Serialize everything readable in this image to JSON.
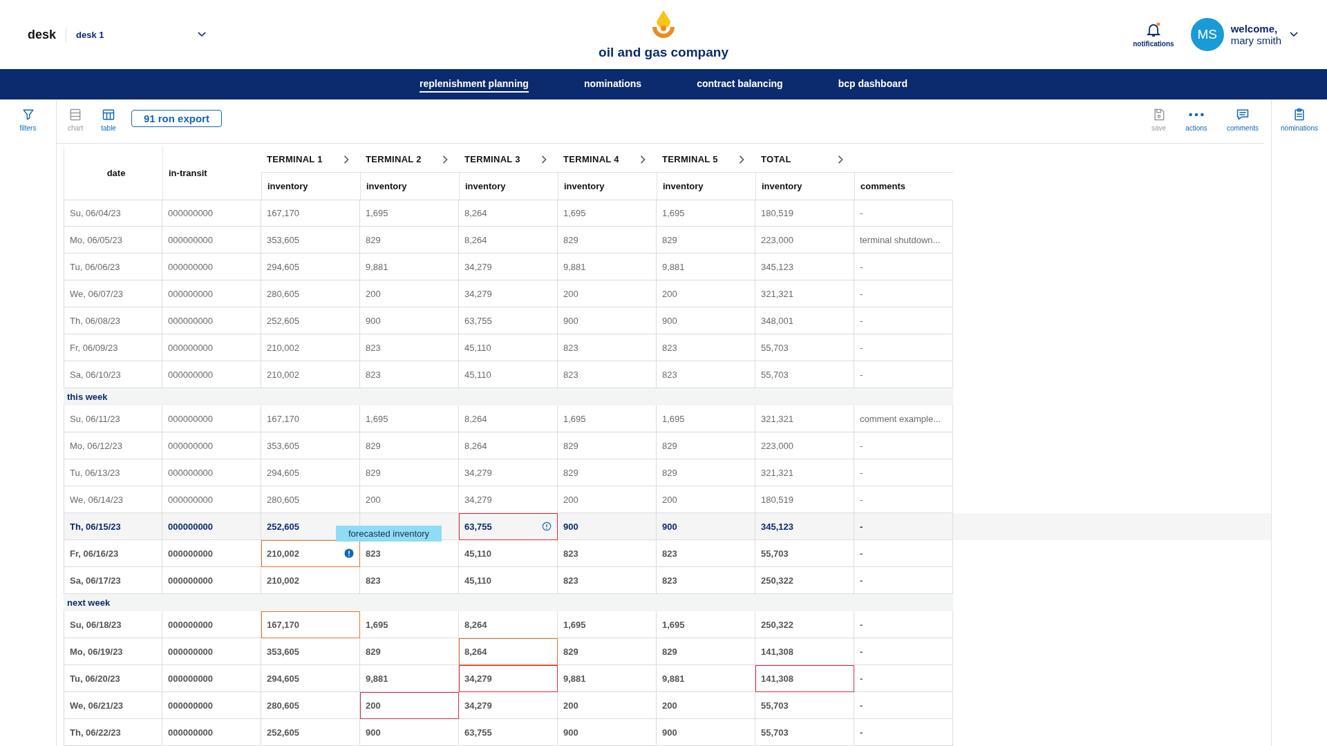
{
  "header": {
    "desk_label": "desk",
    "desk_select": "desk 1",
    "company": "oil and gas company",
    "notifications": "notifications",
    "avatar": "MS",
    "greeting": "welcome,",
    "user": "mary smith"
  },
  "nav": [
    {
      "label": "replenishment planning",
      "selected": true
    },
    {
      "label": "nominations",
      "selected": false
    },
    {
      "label": "contract balancing",
      "selected": false
    },
    {
      "label": "bcp dashboard",
      "selected": false
    }
  ],
  "toolbar": {
    "filters": "filters",
    "views": [
      {
        "kind": "chart",
        "label": "chart",
        "selected": false
      },
      {
        "kind": "table",
        "label": "table",
        "selected": true
      }
    ],
    "export_button": "91 ron export",
    "actions": [
      {
        "kind": "save",
        "label": "save",
        "disabled": true
      },
      {
        "kind": "actions",
        "label": "actions",
        "disabled": false
      },
      {
        "kind": "comments",
        "label": "comments",
        "disabled": false
      }
    ],
    "side_panel": "nominations"
  },
  "table": {
    "columns": [
      {
        "kind": "span",
        "label": "date"
      },
      {
        "kind": "span",
        "label": "in-transit"
      },
      {
        "kind": "group",
        "title": "TERMINAL 1",
        "label": "inventory"
      },
      {
        "kind": "group",
        "title": "TERMINAL 2",
        "label": "inventory"
      },
      {
        "kind": "group",
        "title": "TERMINAL 3",
        "label": "inventory"
      },
      {
        "kind": "group",
        "title": "TERMINAL 4",
        "label": "inventory"
      },
      {
        "kind": "group",
        "title": "TERMINAL 5",
        "label": "inventory"
      },
      {
        "kind": "group",
        "title": "TOTAL",
        "label": "inventory"
      },
      {
        "kind": "sub",
        "label": "comments"
      }
    ],
    "sections": [
      {
        "rows": [
          {
            "kind": "past",
            "selected": false,
            "cells": [
              "Su, 06/04/23",
              "000000000",
              "167,170",
              "1,695",
              "8,264",
              "1,695",
              "1,695",
              "180,519",
              "-"
            ]
          },
          {
            "kind": "past",
            "selected": false,
            "cells": [
              "Mo, 06/05/23",
              "000000000",
              "353,605",
              "829",
              "8,264",
              "829",
              "829",
              "223,000",
              "terminal shutdown..."
            ]
          },
          {
            "kind": "past",
            "selected": false,
            "cells": [
              "Tu, 06/06/23",
              "000000000",
              "294,605",
              "9,881",
              "34,279",
              "9,881",
              "9,881",
              "345,123",
              "-"
            ]
          },
          {
            "kind": "past",
            "selected": false,
            "cells": [
              "We, 06/07/23",
              "000000000",
              "280,605",
              "200",
              "34,279",
              "200",
              "200",
              "321,321",
              "-"
            ]
          },
          {
            "kind": "past",
            "selected": false,
            "cells": [
              "Th, 06/08/23",
              "000000000",
              "252,605",
              "900",
              "63,755",
              "900",
              "900",
              "348,001",
              "-"
            ]
          },
          {
            "kind": "past",
            "selected": false,
            "cells": [
              "Fr, 06/09/23",
              "000000000",
              "210,002",
              "823",
              "45,110",
              "823",
              "823",
              "55,703",
              "-"
            ]
          },
          {
            "kind": "past",
            "selected": false,
            "cells": [
              "Sa, 06/10/23",
              "000000000",
              "210,002",
              "823",
              "45,110",
              "823",
              "823",
              "55,703",
              "-"
            ]
          }
        ]
      },
      {
        "label": "this week",
        "rows": [
          {
            "kind": "past",
            "selected": false,
            "cells": [
              "Su, 06/11/23",
              "000000000",
              "167,170",
              "1,695",
              "8,264",
              "1,695",
              "1,695",
              "321,321",
              "comment example..."
            ]
          },
          {
            "kind": "past",
            "selected": false,
            "cells": [
              "Mo, 06/12/23",
              "000000000",
              "353,605",
              "829",
              "8,264",
              "829",
              "829",
              "223,000",
              "-"
            ]
          },
          {
            "kind": "past",
            "selected": false,
            "cells": [
              "Tu, 06/13/23",
              "000000000",
              "294,605",
              "829",
              "34,279",
              "829",
              "829",
              "321,321",
              "-"
            ]
          },
          {
            "kind": "past",
            "selected": false,
            "cells": [
              "We, 06/14/23",
              "000000000",
              "280,605",
              "200",
              "34,279",
              "200",
              "200",
              "180,519",
              "-"
            ]
          },
          {
            "kind": "forecast",
            "selected": true,
            "cells": [
              "Th, 06/15/23",
              "000000000",
              "252,605",
              {
                "kind": "covered"
              },
              {
                "value": "63,755",
                "kind": "error-info"
              },
              "900",
              "900",
              "345,123",
              "-"
            ]
          },
          {
            "kind": "forecast",
            "selected": false,
            "cells": [
              "Fr, 06/16/23",
              "000000000",
              {
                "value": "210,002",
                "kind": "warning-alert",
                "tooltip": "forecasted inventory"
              },
              "823",
              "45,110",
              "823",
              "823",
              "55,703",
              "-"
            ]
          },
          {
            "kind": "forecast",
            "selected": false,
            "cells": [
              "Sa, 06/17/23",
              "000000000",
              "210,002",
              "823",
              "45,110",
              "823",
              "823",
              "250,322",
              "-"
            ]
          }
        ]
      },
      {
        "label": "next week",
        "rows": [
          {
            "kind": "forecast",
            "selected": false,
            "cells": [
              "Su, 06/18/23",
              "000000000",
              {
                "value": "167,170",
                "kind": "warning"
              },
              "1,695",
              "8,264",
              "1,695",
              "1,695",
              "250,322",
              "-"
            ]
          },
          {
            "kind": "forecast",
            "selected": false,
            "cells": [
              "Mo, 06/19/23",
              "000000000",
              "353,605",
              "829",
              {
                "value": "8,264",
                "kind": "warning"
              },
              "829",
              "829",
              "141,308",
              "-"
            ]
          },
          {
            "kind": "forecast",
            "selected": false,
            "cells": [
              "Tu, 06/20/23",
              "000000000",
              "294,605",
              "9,881",
              {
                "value": "34,279",
                "kind": "error"
              },
              "9,881",
              "9,881",
              {
                "value": "141,308",
                "kind": "error"
              },
              "-"
            ]
          },
          {
            "kind": "forecast",
            "selected": false,
            "cells": [
              "We, 06/21/23",
              "000000000",
              "280,605",
              {
                "value": "200",
                "kind": "error"
              },
              "34,279",
              "200",
              "200",
              "55,703",
              "-"
            ]
          },
          {
            "kind": "forecast",
            "selected": false,
            "cells": [
              "Th, 06/22/23",
              "000000000",
              "252,605",
              "900",
              "63,755",
              "900",
              "900",
              "55,703",
              "-"
            ]
          }
        ]
      }
    ]
  }
}
